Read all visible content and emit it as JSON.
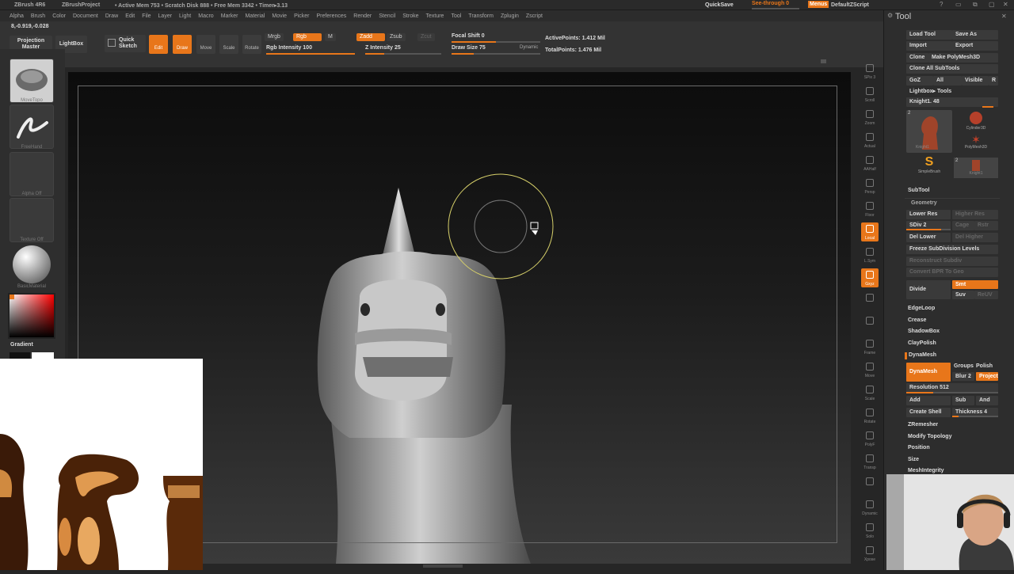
{
  "titlebar": {
    "app": "ZBrush 4R6",
    "project": "ZBrushProject",
    "status": "• Active Mem 753 • Scratch Disk 888 • Free Mem 3342 • Timer▸3.13",
    "quicksave": "QuickSave",
    "seethrough": "See-through  0",
    "menus": "Menus",
    "script": "DefaultZScript"
  },
  "menubar": [
    "Alpha",
    "Brush",
    "Color",
    "Document",
    "Draw",
    "Edit",
    "File",
    "Layer",
    "Light",
    "Macro",
    "Marker",
    "Material",
    "Movie",
    "Picker",
    "Preferences",
    "Render",
    "Stencil",
    "Stroke",
    "Texture",
    "Tool",
    "Transform",
    "Zplugin",
    "Zscript"
  ],
  "toolbar": {
    "coords": "8,-0.919,-0.028",
    "projection_master": "Projection Master",
    "lightbox": "LightBox",
    "quick_sketch": "Quick Sketch",
    "edit": "Edit",
    "draw": "Draw",
    "move": "Move",
    "scale": "Scale",
    "rotate": "Rotate",
    "mrgb": "Mrgb",
    "rgb": "Rgb",
    "m": "M",
    "rgb_intensity": "Rgb  Intensity 100",
    "zadd": "Zadd",
    "zsub": "Zsub",
    "zcut": "Zcut",
    "z_intensity": "Z Intensity 25",
    "focal_shift": "Focal Shift 0",
    "draw_size": "Draw Size 75",
    "dynamic": "Dynamic",
    "active_points": "ActivePoints: 1.412  Mil",
    "total_points": "TotalPoints: 1.476  Mil"
  },
  "leftshelf": {
    "brush_label": "MoveTopo",
    "stroke_label": "FreeHand",
    "alpha_label": "Alpha  Off",
    "texture_label": "Texture  Off",
    "material_label": "BasicMaterial",
    "gradient": "Gradient"
  },
  "rightshelf": [
    "SPix 3",
    "Scroll",
    "Zoom",
    "Actual",
    "AAHalf",
    "Persp",
    "Floor",
    "Local",
    "L.Sym",
    "Gxyz",
    "",
    "",
    "Frame",
    "Move",
    "Scale",
    "Rotate",
    "PolyF",
    "Transp",
    "",
    "Dynamic",
    "Solo",
    "Xpose"
  ],
  "tray": {
    "title": "Tool",
    "load_tool": "Load Tool",
    "save_as": "Save As",
    "import": "Import",
    "export": "Export",
    "clone": "Clone",
    "make_polymesh": "Make PolyMesh3D",
    "clone_all": "Clone  All SubTools",
    "goz": "GoZ",
    "all": "All",
    "visible": "Visible",
    "r": "R",
    "lightbox_tools": "Lightbox▸ Tools",
    "current_tool": "Knight1. 48",
    "tools": [
      "Knight1",
      "Cylinder3D",
      "PolyMesh3D",
      "SimpleBrush",
      "Knight1"
    ],
    "tool_counts": [
      "2",
      "2"
    ],
    "subtool": "SubTool",
    "geometry": "Geometry",
    "lower_res": "Lower Res",
    "higher_res": "Higher Res",
    "sdiv": "SDiv 2",
    "cage": "Cage",
    "rstr": "Rstr",
    "del_lower": "Del Lower",
    "del_higher": "Del Higher",
    "freeze": "Freeze SubDivision Levels",
    "reconstruct": "Reconstruct Subdiv",
    "convert_bpr": "Convert BPR To Geo",
    "divide": "Divide",
    "smt": "Smt",
    "suv": "Suv",
    "reuv": "ReUV",
    "edgeloop": "EdgeLoop",
    "crease": "Crease",
    "shadowbox": "ShadowBox",
    "claypolish": "ClayPolish",
    "dynamesh_header": "DynaMesh",
    "dynamesh": "DynaMesh",
    "groups": "Groups",
    "polish": "Polish",
    "blur": "Blur 2",
    "project": "Project",
    "resolution": "Resolution 512",
    "add": "Add",
    "sub": "Sub",
    "and": "And",
    "create_shell": "Create Shell",
    "thickness": "Thickness 4",
    "zremesher": "ZRemesher",
    "modify_topology": "Modify Topology",
    "position": "Position",
    "size": "Size",
    "meshintegrity": "MeshIntegrity"
  },
  "colors": {
    "accent": "#e8761a",
    "panel": "#2d2d2d",
    "canvas_top": "#0c0c0c"
  },
  "sliders": {
    "rgb_intensity": 1.0,
    "z_intensity": 0.25,
    "focal_shift": 0.5,
    "draw_size": 0.25
  }
}
